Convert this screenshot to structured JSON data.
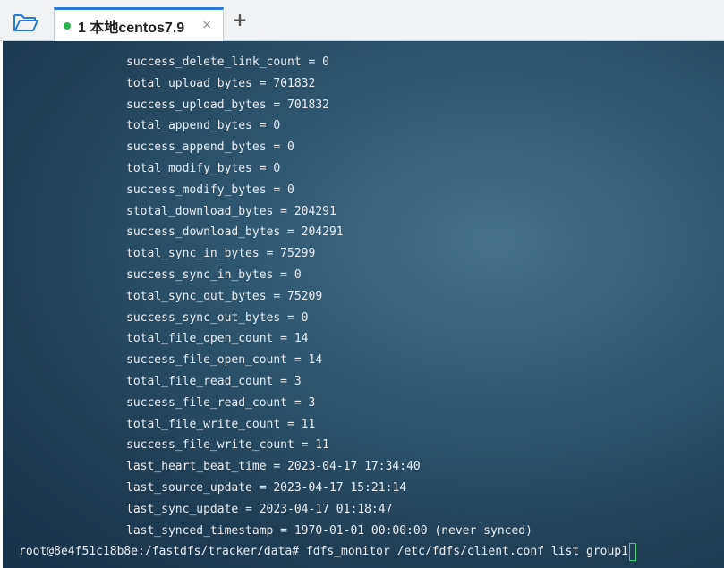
{
  "tabbar": {
    "folder_icon": "folder-open-icon",
    "tab": {
      "label": "1 本地centos7.9",
      "status_color": "#28b24b",
      "close_glyph": "×"
    },
    "new_tab_glyph": "+"
  },
  "terminal": {
    "lines": [
      "success_delete_link_count = 0",
      "total_upload_bytes = 701832",
      "success_upload_bytes = 701832",
      "total_append_bytes = 0",
      "success_append_bytes = 0",
      "total_modify_bytes = 0",
      "success_modify_bytes = 0",
      "stotal_download_bytes = 204291",
      "success_download_bytes = 204291",
      "total_sync_in_bytes = 75299",
      "success_sync_in_bytes = 0",
      "total_sync_out_bytes = 75209",
      "success_sync_out_bytes = 0",
      "total_file_open_count = 14",
      "success_file_open_count = 14",
      "total_file_read_count = 3",
      "success_file_read_count = 3",
      "total_file_write_count = 11",
      "success_file_write_count = 11",
      "last_heart_beat_time = 2023-04-17 17:34:40",
      "last_source_update = 2023-04-17 15:21:14",
      "last_sync_update = 2023-04-17 01:18:47",
      "last_synced_timestamp = 1970-01-01 00:00:00 (never synced)"
    ],
    "prompt": "root@8e4f51c18b8e:/fastdfs/tracker/data# fdfs_monitor /etc/fdfs/client.conf list group1",
    "cursor_color": "#3fd07a"
  }
}
